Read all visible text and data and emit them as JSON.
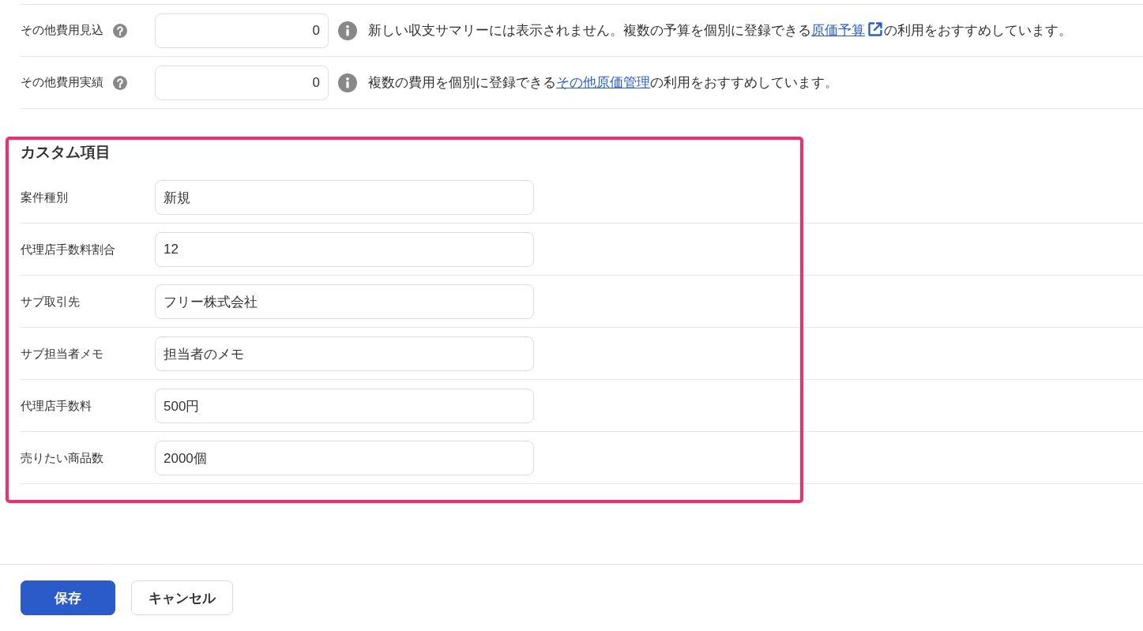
{
  "other_costs": {
    "rows": [
      {
        "label": "その他費用見込",
        "help": true,
        "value": "0",
        "note": {
          "before": "新しい収支サマリーには表示されません。複数の予算を個別に登録できる",
          "link": {
            "label": "原価予算",
            "external": true
          },
          "after": "の利用をおすすめしています。"
        }
      },
      {
        "label": "その他費用実績",
        "help": true,
        "value": "0",
        "note": {
          "before": "複数の費用を個別に登録できる",
          "link": {
            "label": "その他原価管理",
            "external": false
          },
          "after": "の利用をおすすめしています。"
        }
      }
    ]
  },
  "custom_fields": {
    "title": "カスタム項目",
    "highlighted": true,
    "rows": [
      {
        "label": "案件種別",
        "value": "新規"
      },
      {
        "label": "代理店手数料割合",
        "value": "12"
      },
      {
        "label": "サブ取引先",
        "value": "フリー株式会社"
      },
      {
        "label": "サブ担当者メモ",
        "value": "担当者のメモ"
      },
      {
        "label": "代理店手数料",
        "value": "500円"
      },
      {
        "label": "売りたい商品数",
        "value": "2000個"
      }
    ]
  },
  "actions": [
    {
      "label": "保存",
      "kind": "save"
    },
    {
      "label": "キャンセル",
      "kind": "cancel"
    }
  ]
}
